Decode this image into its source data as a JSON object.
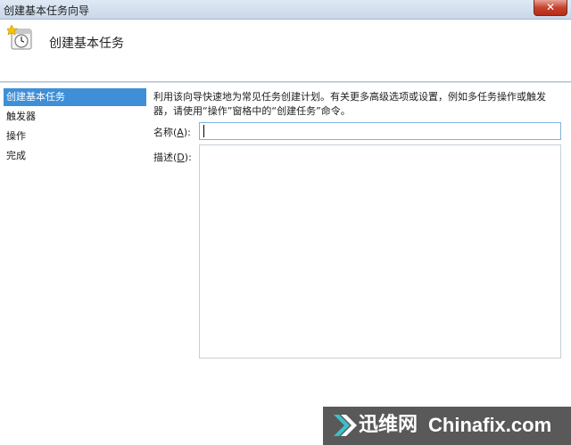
{
  "window": {
    "title": "创建基本任务向导",
    "close_label": "✕"
  },
  "header": {
    "title": "创建基本任务"
  },
  "steps": [
    {
      "label": "创建基本任务"
    },
    {
      "label": "触发器"
    },
    {
      "label": "操作"
    },
    {
      "label": "完成"
    }
  ],
  "main": {
    "description": "利用该向导快速地为常见任务创建计划。有关更多高级选项或设置，例如多任务操作或触发器，请使用“操作”窗格中的“创建任务”命令。",
    "name_label": "名称(",
    "name_key": "A",
    "name_label_end": "):",
    "name_value": "",
    "desc_label": "描述(",
    "desc_key": "D",
    "desc_label_end": "):",
    "desc_value": ""
  },
  "watermark": {
    "cn": "迅维网",
    "en": "Chinafix.com"
  }
}
